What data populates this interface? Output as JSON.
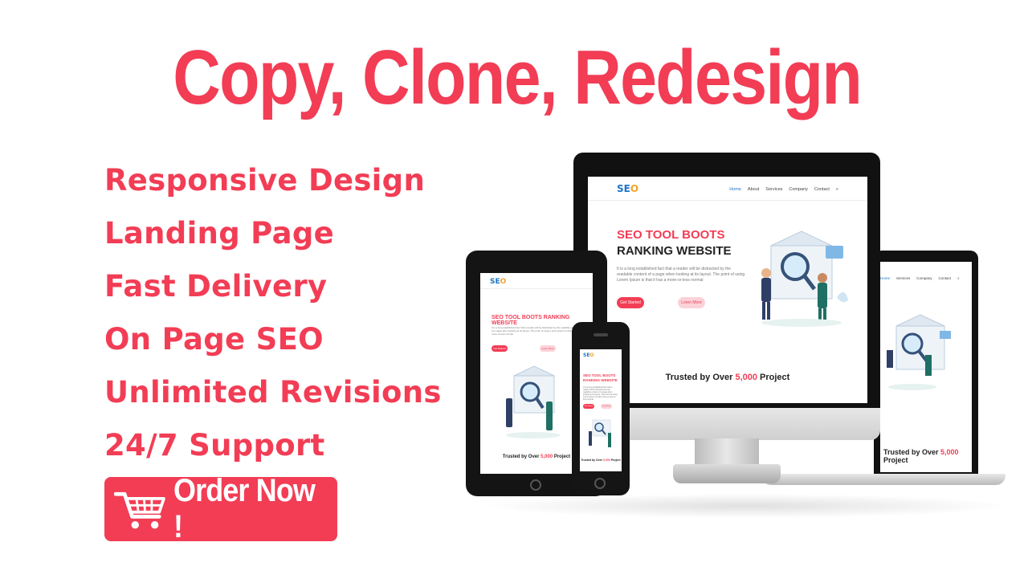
{
  "headline": "Copy, Clone, Redesign",
  "features": [
    "Responsive Design",
    "Landing Page",
    "Fast Delivery",
    "On Page SEO",
    "Unlimited Revisions",
    "24/7 Support"
  ],
  "cta": {
    "label": "Order Now !",
    "icon": "shopping-cart-icon"
  },
  "mock_site": {
    "logo": "SEO",
    "menu": [
      "Home",
      "About",
      "Services",
      "Company",
      "Contact"
    ],
    "hero_line1": "SEO TOOL BOOTS",
    "hero_line2": "RANKING WEBSITE",
    "hero_combined": "SEO TOOL BOOTS RANKING WEBSITE",
    "paragraph": "It is a long established fact that a reader will be distracted by the readable content of a page when looking at its layout. The point of using Lorem Ipsum is that it has a more-or-less normal",
    "button_primary": "Get Started",
    "button_secondary": "Loren More",
    "trusted_prefix": "Trusted by Over ",
    "trusted_number": "5,000",
    "trusted_suffix": " Project"
  },
  "colors": {
    "accent": "#f23d55",
    "link_blue": "#1f74c7",
    "logo_orange": "#f4a12a"
  }
}
